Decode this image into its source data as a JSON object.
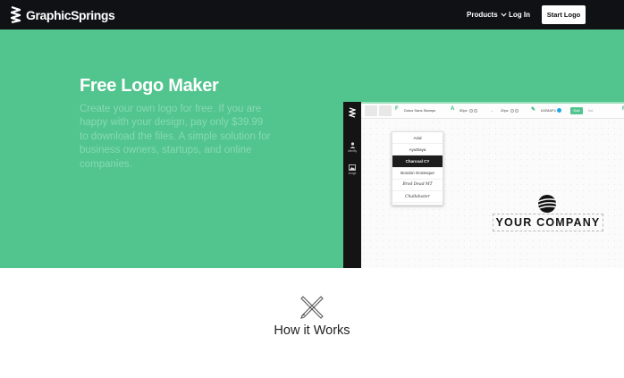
{
  "nav": {
    "brand": "GraphicSprings",
    "products": "Products",
    "login": "Log In",
    "start_logo": "Start Logo"
  },
  "hero": {
    "title": "Free Logo Maker",
    "description": "Create your own logo for free. If you are happy with your design, pay only $39.99 to download the files. A simple solution for business owners, startups, and online companies."
  },
  "editor": {
    "sidebar": {
      "identity": "Identity",
      "image": "Image"
    },
    "toolbar": {
      "font_name": "Dolus Sans Stamps",
      "size_label": "50px",
      "spacing_label": "20px",
      "color_label": "#1E8AF4",
      "bold_label": "Bold"
    },
    "font_options": [
      "Arial",
      "Ayuthaya",
      "Charcoal CY",
      "Bondon Grotesque",
      "Brod Dead MT",
      "Chalkduster"
    ],
    "selected_font_index": 2,
    "company_text": "YOUR COMPANY"
  },
  "how_it_works": {
    "title": "How it Works"
  },
  "colors": {
    "nav_bg": "#0f1115",
    "hero_bg": "#52c48e",
    "accent": "#52c48e"
  }
}
